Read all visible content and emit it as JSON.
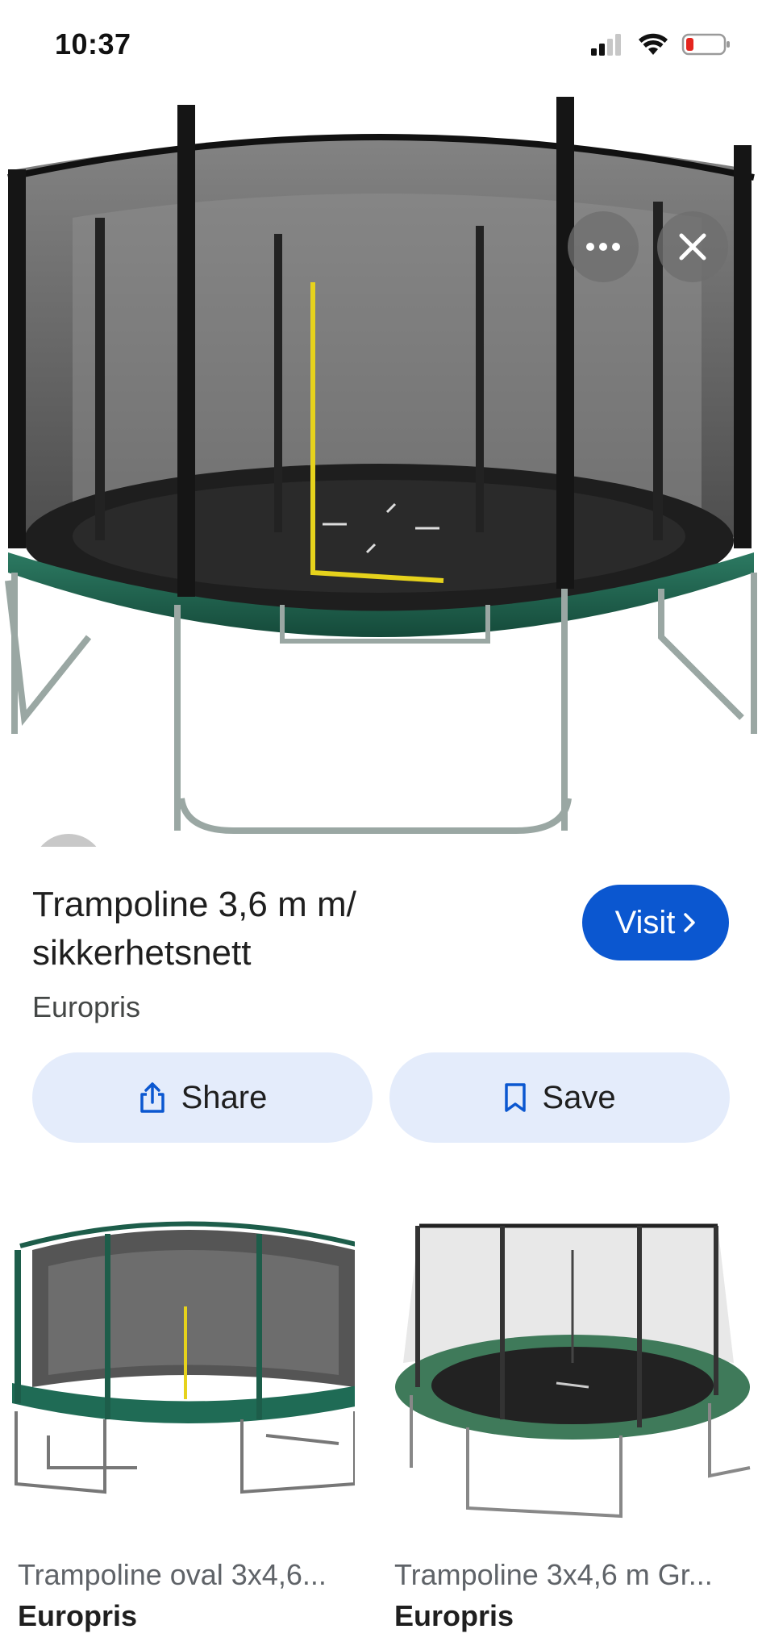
{
  "status_bar": {
    "time": "10:37"
  },
  "hero": {
    "more_icon": "more-horizontal-icon",
    "close_icon": "close-icon",
    "lens_icon": "google-lens-icon"
  },
  "result": {
    "title": "Trampoline 3,6 m m/ sikkerhetsnett",
    "source": "Europris",
    "visit_label": "Visit",
    "share_label": "Share",
    "save_label": "Save"
  },
  "related": [
    {
      "title": "Trampoline oval 3x4,6...",
      "source": "Europris"
    },
    {
      "title": "Trampoline 3x4,6 m Gr...",
      "source": "Europris"
    }
  ],
  "colors": {
    "accent": "#0b57d0",
    "chip_bg": "#e4ecfb",
    "pad_green": "#1f5f4c"
  }
}
